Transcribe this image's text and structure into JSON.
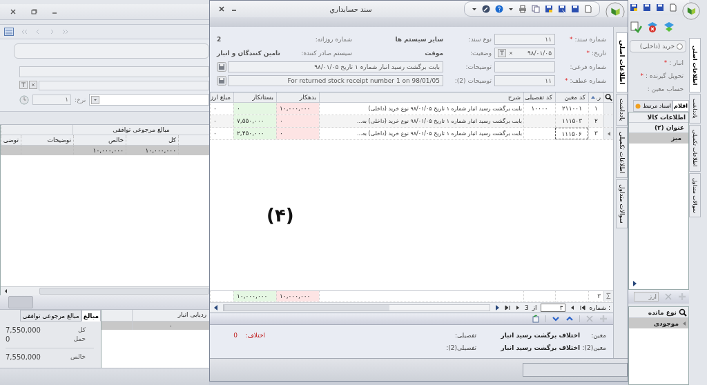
{
  "left_pane": {
    "rate": {
      "label": "نرخ:",
      "value": "۱"
    },
    "grid": {
      "group_header": "مبالغ مرجوعی توافقی",
      "columns": [
        "کل",
        "خالص",
        "توضیحات",
        "توضی"
      ],
      "rows": [
        {
          "cells": [
            "۱۰,۰۰۰,۰۰۰",
            "۱۰,۰۰۰,۰۰۰"
          ],
          "selected": true
        }
      ]
    },
    "tracking_grid": {
      "column": "ردیابی انبار",
      "value": "۰"
    },
    "summary_tabs": [
      {
        "label": "مبالغ",
        "selected": true
      },
      {
        "label": "مبالغ مرجوعی توافقی",
        "selected": false
      }
    ],
    "summary": [
      {
        "label": "کل",
        "value": "7,550,000",
        "kind": "line"
      },
      {
        "label": "حمل",
        "value": "0",
        "kind": "line"
      },
      {
        "label": "خالص",
        "value": "7,550,000",
        "kind": "total"
      }
    ]
  },
  "dialog": {
    "title": "سند حسابداري",
    "doc_number": {
      "label": "شماره سند:",
      "required_mark": "*",
      "value": "۱۱"
    },
    "date": {
      "label": "تاریخ:",
      "required_mark": "*",
      "value": "۹۸/۰۱/۰۵"
    },
    "sub_number": {
      "label": "شماره فرعی:"
    },
    "ref_number": {
      "label": "شماره عطف:",
      "required_mark": "*",
      "value": "۱۱"
    },
    "doc_type": {
      "label": "نوع سند:",
      "value": "سایر سیستم ها"
    },
    "status": {
      "label": "وضعیت:",
      "value": "موقت"
    },
    "daily_number": {
      "label": "شماره روزانه:",
      "value": "2"
    },
    "issuer": {
      "label": "سیستم صادر کننده:",
      "value": "تامین کنندگان و انبار"
    },
    "descriptions": [
      {
        "label": "توضیحات:",
        "value": "بابت برگشت رسید انبار شماره ۱ تاریخ ۹۸/۰۱/۰۵"
      },
      {
        "label": "توضیحات (2):",
        "value": "For returned stock receipt number 1 on 98/01/05"
      }
    ],
    "side_tabs": [
      {
        "label": "اطلاعات اصلی",
        "selected": true
      },
      {
        "label": "یادداشت",
        "selected": false
      },
      {
        "label": "اطلاعات تکمیلی",
        "selected": false
      },
      {
        "label": "سوالات متداول",
        "selected": false
      }
    ],
    "grid": {
      "columns": [
        "ر.",
        "کد معین",
        "کد تفصیلی",
        "شرح",
        "بدهکار",
        "بستانکار",
        "مبلغ ارز"
      ],
      "rows": [
        {
          "cells": [
            "۱",
            "۲۱۱۰۰۱",
            "۱۰۰۰۰",
            "بابت برگشت رسید انبار شماره ۱ تاریخ ۹۸/۰۱/۰۵ نوع خرید (داخلی)",
            "۱۰,۰۰۰,۰۰۰",
            "۰",
            "۰"
          ],
          "focused": false
        },
        {
          "cells": [
            "۲",
            "۱۱۱۵۰۳",
            "",
            "بابت برگشت رسید انبار شماره ۱ تاریخ ۹۸/۰۱/۰۵ نوع خرید (داخلی) به...",
            "۰",
            "۷,۵۵۰,۰۰۰",
            "۰"
          ],
          "focused": false
        },
        {
          "cells": [
            "۳",
            "۱۱۱۵۰۶",
            "",
            "بابت برگشت رسید انبار شماره ۱ تاریخ ۹۸/۰۱/۰۵ نوع خرید (داخلی) به...",
            "۰",
            "۲,۴۵۰,۰۰۰",
            "۰"
          ],
          "focused": true
        }
      ],
      "totals": {
        "count": "۳",
        "debit": "۱۰,۰۰۰,۰۰۰",
        "credit": "۱۰,۰۰۰,۰۰۰"
      }
    },
    "overlay_label": "(۴)",
    "pager": {
      "label": ": شماره",
      "current": "۳",
      "of": "از",
      "total": "3"
    },
    "footer": {
      "moein_label": "معین:",
      "moein": "اختلاف برگشت رسید انبار",
      "tafsili_label": "تفصیلی:",
      "diff_label": "اختلاف:",
      "diff": "0",
      "moein2_label": "معین(2):",
      "moein2": "اختلاف برگشت رسید انبار",
      "tafsili2_label": "تفصیلی(2):"
    }
  },
  "right_pane": {
    "radio": {
      "label": "خرید (داخلی)",
      "checked": false
    },
    "labels": [
      {
        "label": "انبار :",
        "required_mark": "*"
      },
      {
        "label": "تحویل گیرنده :",
        "required_mark": "*"
      },
      {
        "label": "حساب معین :"
      }
    ],
    "tabs": [
      {
        "label": "اقلام",
        "selected": true
      },
      {
        "label": "اسناد مرتبط",
        "selected": false
      }
    ],
    "group_header": "اطلاعات کالا",
    "column": "عنوان (۲)",
    "cell": "میز",
    "currency_placeholder": "ارز",
    "balance_column": "نوع مانده",
    "balance_value": "موجودی",
    "side_tabs": [
      {
        "label": "اطلاعات اصلی",
        "selected": true
      },
      {
        "label": "یادداشت",
        "selected": false
      },
      {
        "label": "اطلاعات تکمیلی",
        "selected": false
      },
      {
        "label": "سوالات متداول",
        "selected": false
      }
    ]
  }
}
